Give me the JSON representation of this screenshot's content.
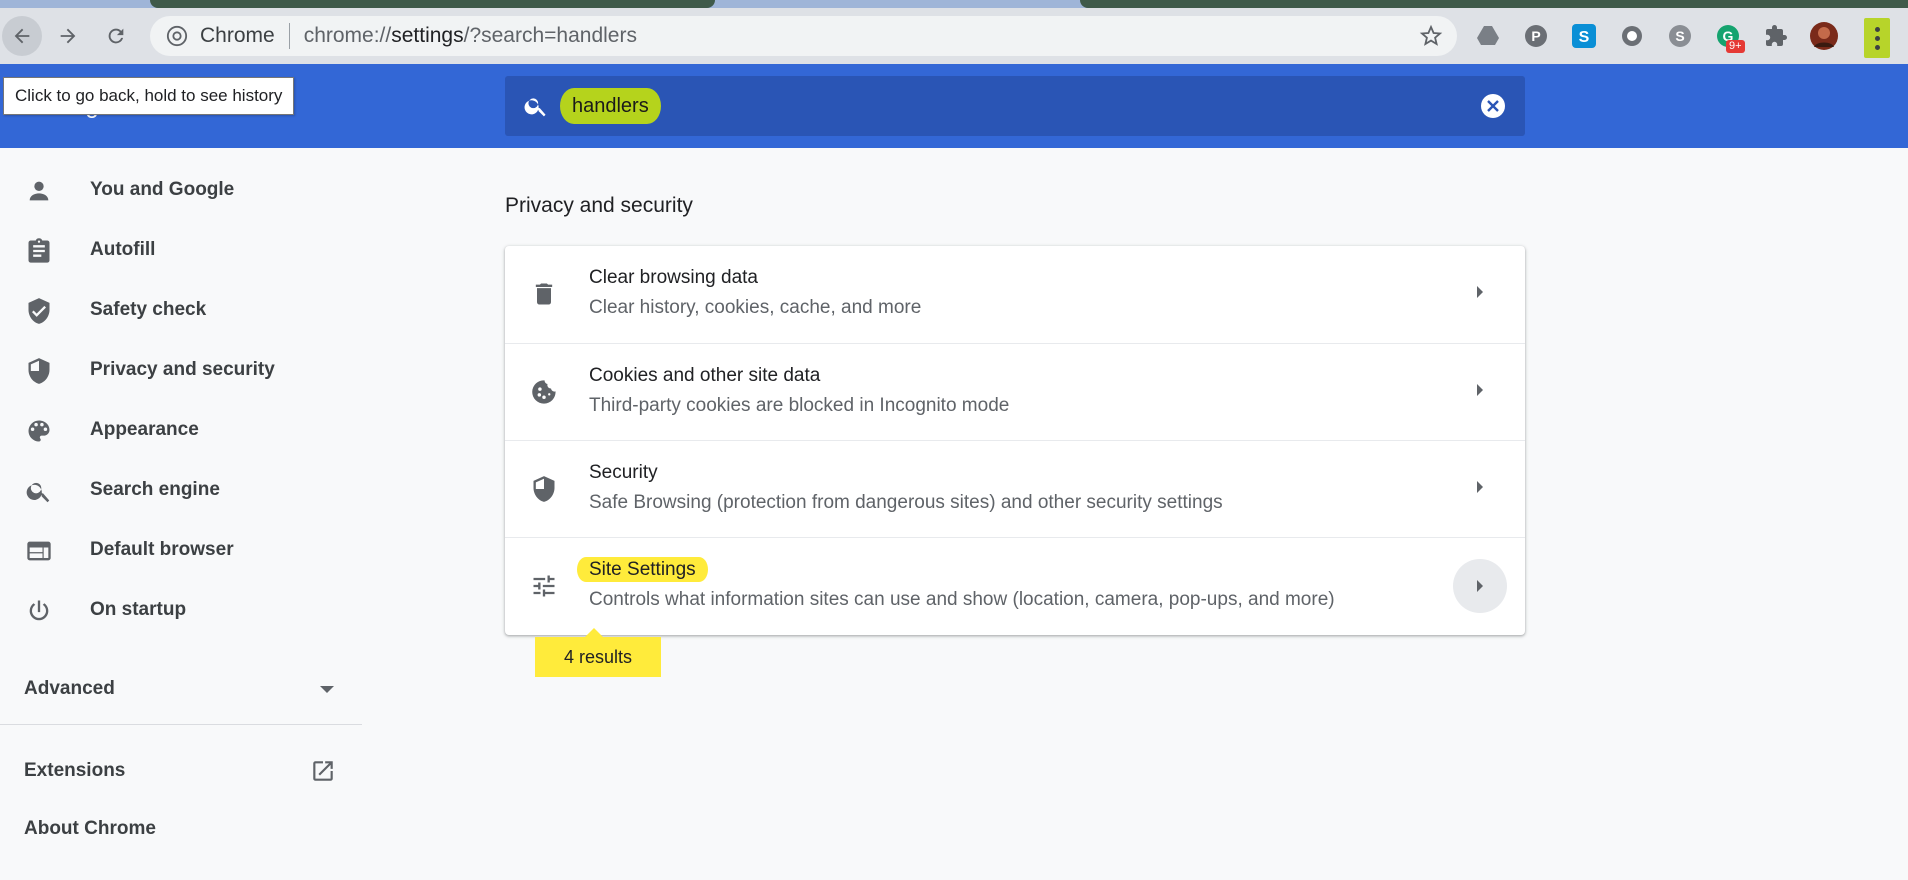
{
  "browser": {
    "site_chip": "Chrome",
    "url_scheme": "chrome://",
    "url_host": "settings",
    "url_rest": "/?search=handlers",
    "extension_badge": "9+"
  },
  "tooltip": "Click to go back, hold to see history",
  "header": {
    "title": "Settings",
    "search_query": "handlers"
  },
  "sidebar": {
    "items": [
      {
        "label": "You and Google",
        "icon": "person-icon"
      },
      {
        "label": "Autofill",
        "icon": "clipboard-icon"
      },
      {
        "label": "Safety check",
        "icon": "shield-check-icon"
      },
      {
        "label": "Privacy and security",
        "icon": "shield-half-icon"
      },
      {
        "label": "Appearance",
        "icon": "palette-icon"
      },
      {
        "label": "Search engine",
        "icon": "search-icon"
      },
      {
        "label": "Default browser",
        "icon": "browser-window-icon"
      },
      {
        "label": "On startup",
        "icon": "power-icon"
      }
    ],
    "advanced": "Advanced",
    "extensions": "Extensions",
    "about": "About Chrome"
  },
  "main": {
    "section_title": "Privacy and security",
    "rows": [
      {
        "title": "Clear browsing data",
        "subtitle": "Clear history, cookies, cache, and more",
        "icon": "trash-icon"
      },
      {
        "title": "Cookies and other site data",
        "subtitle": "Third-party cookies are blocked in Incognito mode",
        "icon": "cookie-icon"
      },
      {
        "title": "Security",
        "subtitle": "Safe Browsing (protection from dangerous sites) and other security settings",
        "icon": "shield-half-icon"
      },
      {
        "title": "Site Settings",
        "subtitle": "Controls what information sites can use and show (location, camera, pop-ups, and more)",
        "icon": "tune-icon"
      }
    ],
    "results_bubble": "4 results"
  },
  "colors": {
    "header_blue": "#3367d6",
    "search_bg": "#2a55b5",
    "highlight_yellow": "#ffeb3b",
    "query_highlight": "#b5d31c"
  }
}
